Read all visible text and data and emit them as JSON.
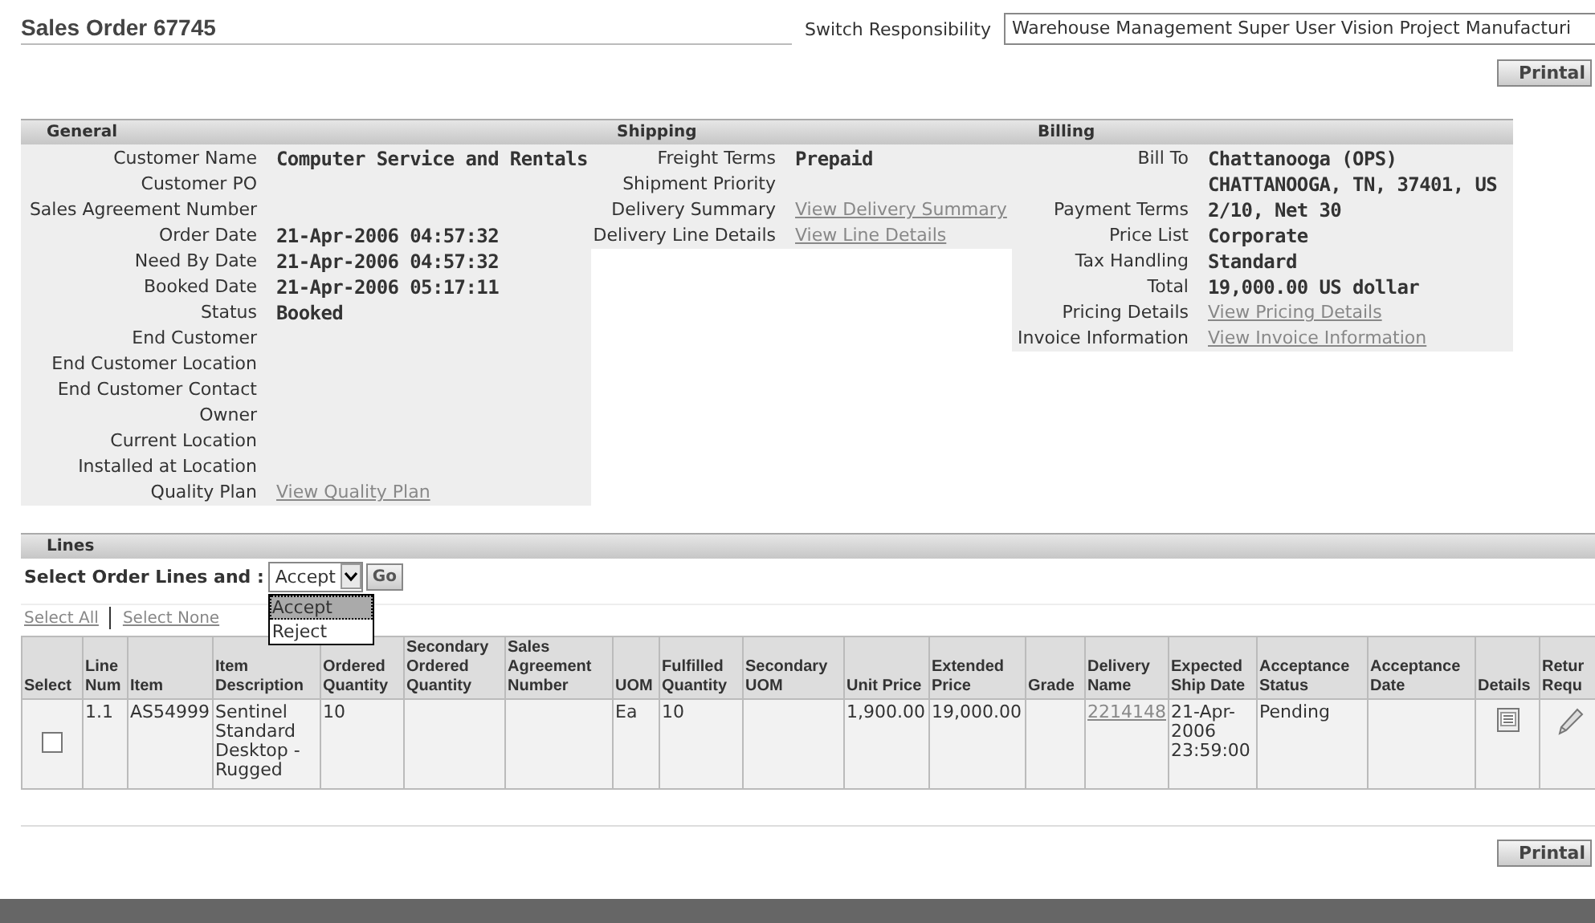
{
  "header": {
    "title": "Sales Order 67745",
    "switch_label": "Switch Responsibility",
    "responsibility": "Warehouse Management Super User Vision Project Manufacturi"
  },
  "top_button": "Printal",
  "sections": [
    {
      "title": "General",
      "rows": [
        {
          "label": "Customer Name",
          "kind": "text",
          "value": "Computer Service and Rentals"
        },
        {
          "label": "Customer PO"
        },
        {
          "label": "Sales Agreement Number"
        },
        {
          "label": "Order Date",
          "kind": "text",
          "value": "21-Apr-2006 04:57:32"
        },
        {
          "label": "Need By Date",
          "kind": "text",
          "value": "21-Apr-2006 04:57:32"
        },
        {
          "label": "Booked Date",
          "kind": "text",
          "value": "21-Apr-2006 05:17:11"
        },
        {
          "label": "Status",
          "kind": "text",
          "value": "Booked"
        },
        {
          "label": "End Customer"
        },
        {
          "label": "End Customer Location"
        },
        {
          "label": "End Customer Contact"
        },
        {
          "label": "Owner"
        },
        {
          "label": "Current Location"
        },
        {
          "label": "Installed at Location"
        },
        {
          "label": "Quality Plan",
          "kind": "link",
          "value": "View Quality Plan"
        }
      ]
    },
    {
      "title": "Shipping",
      "rows": [
        {
          "label": "Freight Terms",
          "kind": "text",
          "value": "Prepaid"
        },
        {
          "label": "Shipment Priority"
        },
        {
          "label": "Delivery Summary",
          "kind": "link",
          "value": "View Delivery Summary"
        },
        {
          "label": "Delivery Line Details",
          "kind": "link",
          "value": "View Line Details"
        }
      ]
    },
    {
      "title": "Billing",
      "rows": [
        {
          "label": "Bill To",
          "kind": "text",
          "value": "Chattanooga (OPS)"
        },
        {
          "kind": "text",
          "value": "CHATTANOOGA, TN, 37401, US"
        },
        {
          "label": "Payment Terms",
          "kind": "text",
          "value": "2/10, Net 30"
        },
        {
          "label": "Price List",
          "kind": "text",
          "value": "Corporate"
        },
        {
          "label": "Tax Handling",
          "kind": "text",
          "value": "Standard"
        },
        {
          "label": "Total",
          "kind": "text",
          "value": "19,000.00 US dollar"
        },
        {
          "label": "Pricing Details",
          "kind": "link",
          "value": "View Pricing Details"
        },
        {
          "label": "Invoice Information",
          "kind": "link",
          "value": "View Invoice Information"
        }
      ]
    }
  ],
  "lines": {
    "title": "Lines",
    "action_label": "Select Order Lines and :",
    "action_value": "Accept",
    "go": "Go",
    "options": [
      {
        "label": "Accept",
        "selected": true
      },
      {
        "label": "Reject",
        "selected": false
      }
    ],
    "select_all": "Select All",
    "select_none": "Select None",
    "columns": [
      {
        "label": "Select",
        "kind": "checkbox"
      },
      {
        "label": "Line Num",
        "kind": "text"
      },
      {
        "label": "Item",
        "kind": "text"
      },
      {
        "label": "Item Description",
        "kind": "text"
      },
      {
        "label": "Ordered Quantity",
        "kind": "text"
      },
      {
        "label": "Secondary Ordered Quantity",
        "kind": "text"
      },
      {
        "label": "Sales Agreement Number",
        "kind": "text"
      },
      {
        "label": "UOM",
        "kind": "text"
      },
      {
        "label": "Fulfilled Quantity",
        "kind": "text"
      },
      {
        "label": "Secondary UOM",
        "kind": "text"
      },
      {
        "label": "Unit Price",
        "kind": "text"
      },
      {
        "label": "Extended Price",
        "kind": "text"
      },
      {
        "label": "Grade",
        "kind": "text"
      },
      {
        "label": "Delivery Name",
        "kind": "link"
      },
      {
        "label": "Expected Ship Date",
        "kind": "text"
      },
      {
        "label": "Acceptance Status",
        "kind": "text"
      },
      {
        "label": "Acceptance Date",
        "kind": "text"
      },
      {
        "label": "Details",
        "kind": "details"
      },
      {
        "label": "Retur Requ",
        "kind": "edit"
      }
    ],
    "rows": [
      {
        "checked": false,
        "cells": [
          null,
          "1.1",
          "AS54999",
          "Sentinel Standard Desktop - Rugged",
          "10",
          null,
          null,
          "Ea",
          "10",
          null,
          "1,900.00",
          "19,000.00",
          null,
          "2214148",
          "21-Apr-2006 23:59:00",
          "Pending",
          null,
          null,
          null
        ]
      }
    ]
  },
  "bottom_button": "Printal"
}
